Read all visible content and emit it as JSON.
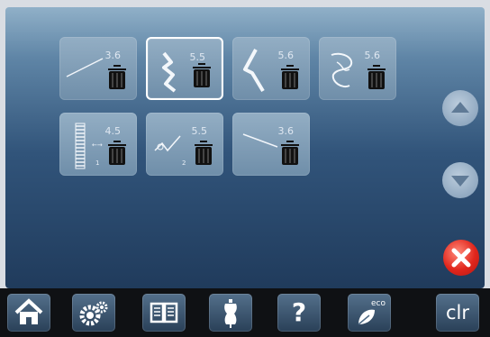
{
  "tiles": [
    {
      "value": "3.6",
      "mini": "",
      "mini2": ""
    },
    {
      "value": "5.5",
      "mini": "",
      "mini2": ""
    },
    {
      "value": "5.6",
      "mini": "",
      "mini2": ""
    },
    {
      "value": "5.6",
      "mini": "",
      "mini2": ""
    },
    {
      "value": "4.5",
      "mini": "←→",
      "mini2": "1"
    },
    {
      "value": "5.5",
      "mini": "",
      "mini2": "2"
    },
    {
      "value": "3.6",
      "mini": "",
      "mini2": ""
    }
  ],
  "toolbar": {
    "clr_label": "clr",
    "eco_label": "eco",
    "help_label": "?"
  },
  "colors": {
    "accent_close": "#e1261c",
    "screen_top": "#90b0c8",
    "screen_bottom": "#203b5c"
  },
  "icons": [
    "home-icon",
    "settings-icon",
    "tutorial-book-icon",
    "dress-form-icon",
    "help-icon",
    "eco-leaf-icon",
    "clear-icon",
    "trash-icon",
    "scroll-up-icon",
    "scroll-down-icon",
    "close-icon"
  ]
}
